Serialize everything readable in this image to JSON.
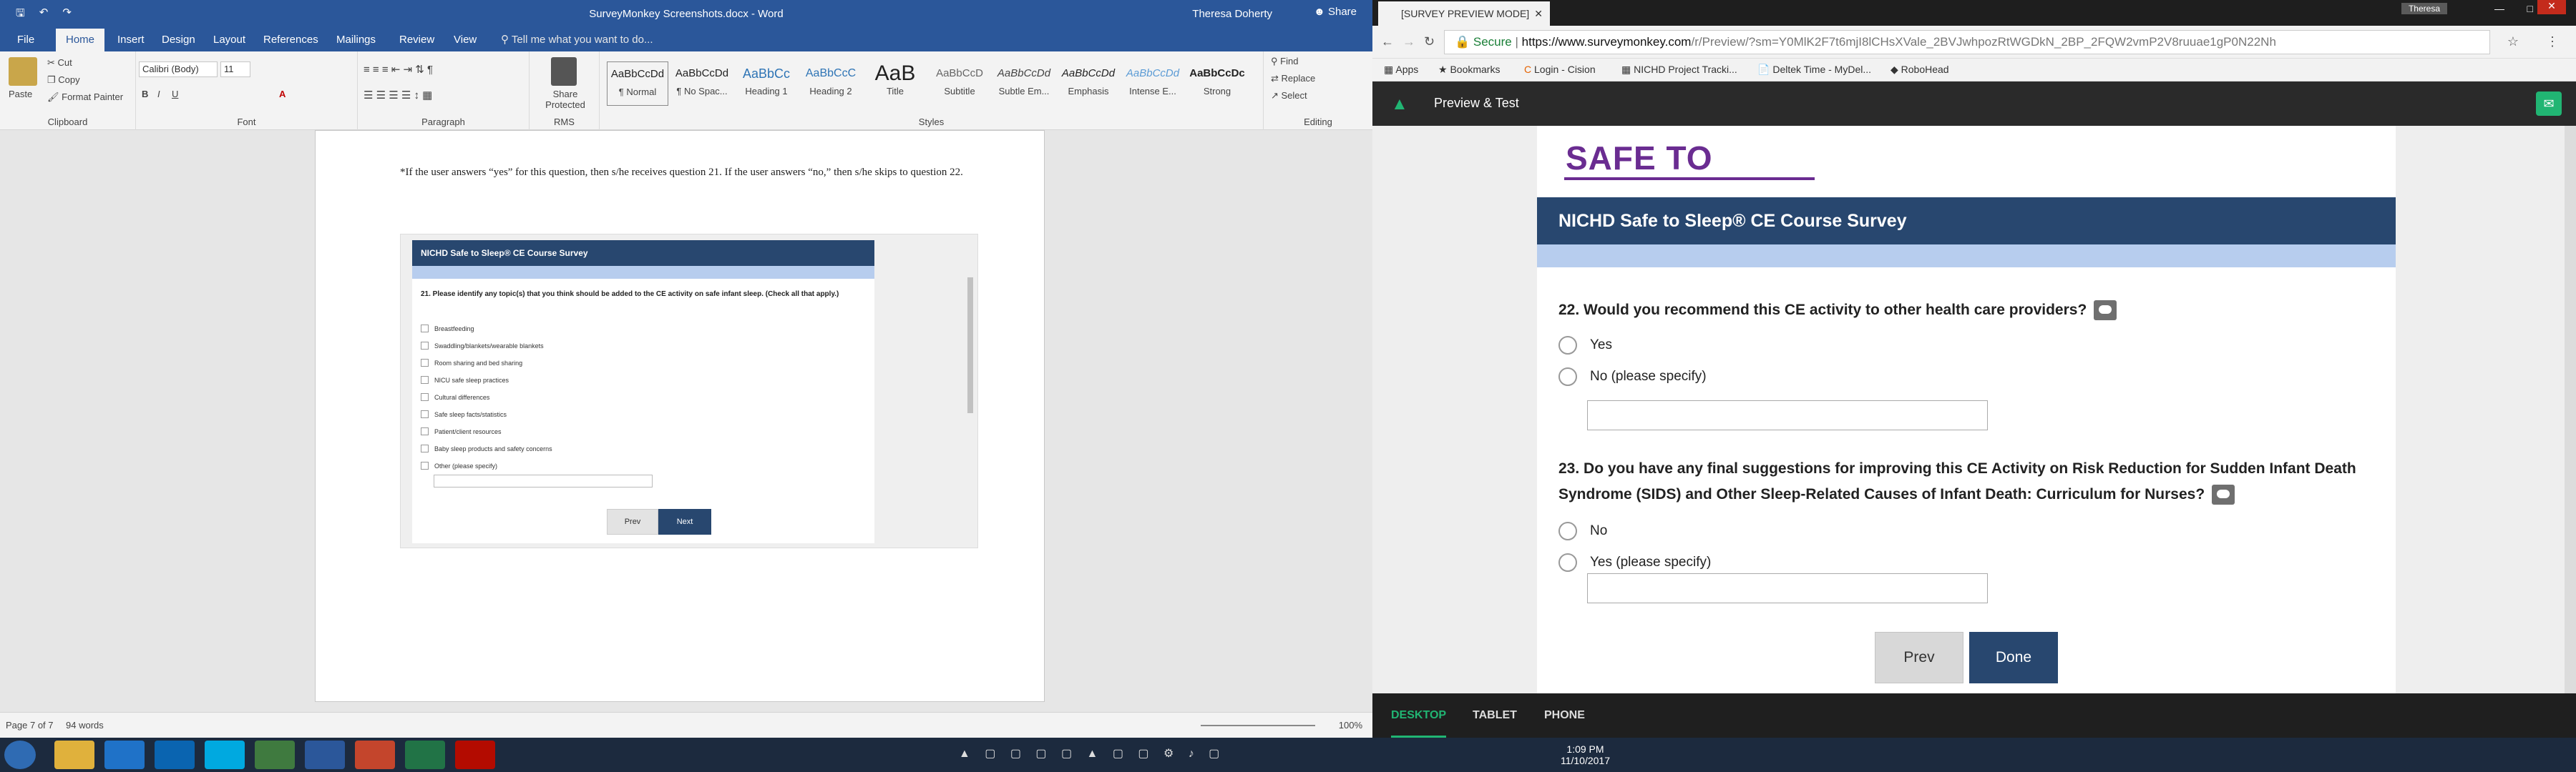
{
  "word": {
    "title": "SurveyMonkey Screenshots.docx - Word",
    "user": "Theresa Doherty",
    "share": "Share",
    "tabs": [
      "File",
      "Home",
      "Insert",
      "Design",
      "Layout",
      "References",
      "Mailings",
      "Review",
      "View"
    ],
    "tell_me": "Tell me what you want to do...",
    "clipboard": {
      "paste": "Paste",
      "cut": "Cut",
      "copy": "Copy",
      "format_painter": "Format Painter",
      "label": "Clipboard"
    },
    "font": {
      "name": "Calibri (Body)",
      "size": "11",
      "label": "Font"
    },
    "paragraph_label": "Paragraph",
    "rms": {
      "share_protected": "Share Protected",
      "label": "RMS"
    },
    "styles": [
      {
        "preview": "AaBbCcDd",
        "name": "¶ Normal"
      },
      {
        "preview": "AaBbCcDd",
        "name": "¶ No Spac..."
      },
      {
        "preview": "AaBbCc",
        "name": "Heading 1"
      },
      {
        "preview": "AaBbCcC",
        "name": "Heading 2"
      },
      {
        "preview": "AaB",
        "name": "Title"
      },
      {
        "preview": "AaBbCcD",
        "name": "Subtitle"
      },
      {
        "preview": "AaBbCcDd",
        "name": "Subtle Em..."
      },
      {
        "preview": "AaBbCcDd",
        "name": "Emphasis"
      },
      {
        "preview": "AaBbCcDd",
        "name": "Intense E..."
      },
      {
        "preview": "AaBbCcDc",
        "name": "Strong"
      }
    ],
    "styles_label": "Styles",
    "editing": {
      "find": "Find",
      "replace": "Replace",
      "select": "Select",
      "label": "Editing"
    },
    "paragraph_text": "*If the user answers “yes” for this question, then s/he receives question 21. If the user answers “no,” then s/he skips to question 22.",
    "embedded": {
      "header": "NICHD Safe to Sleep® CE Course Survey",
      "question": "21. Please identify any topic(s) that you think should be added to the CE activity on safe infant sleep. (Check all that apply.)",
      "options": [
        "Breastfeeding",
        "Swaddling/blankets/wearable blankets",
        "Room sharing and bed sharing",
        "NICU safe sleep practices",
        "Cultural differences",
        "Safe sleep facts/statistics",
        "Patient/client resources",
        "Baby sleep products and safety concerns",
        "Other (please specify)"
      ],
      "prev": "Prev",
      "next": "Next"
    },
    "status": {
      "page": "Page 7 of 7",
      "words": "94 words",
      "zoom": "100%"
    }
  },
  "chrome": {
    "tab_title": "[SURVEY PREVIEW MODE]",
    "profile": "Theresa",
    "url_secure": "Secure",
    "url_domain": "https://www.surveymonkey.com",
    "url_path": "/r/Preview/?sm=Y0MlK2F7t6mjI8lCHsXVale_2BVJwhpozRtWGDkN_2BP_2FQW2vmP2V8ruuae1gP0N22Nh",
    "bookmarks": [
      "Apps",
      "Bookmarks",
      "Login - Cision",
      "NICHD Project Tracki...",
      "Deltek Time - MyDel...",
      "RoboHead"
    ]
  },
  "survey": {
    "bar_title": "Preview & Test",
    "logo_text": "SAFE TO SLEEP",
    "header": "NICHD Safe to Sleep® CE Course Survey",
    "q22": "22. Would you recommend this CE activity to other health care providers?",
    "q22_options": [
      "Yes",
      "No (please specify)"
    ],
    "q23": "23. Do you have any final suggestions for improving this CE Activity on Risk Reduction for Sudden Infant Death Syndrome (SIDS) and Other Sleep-Related Causes of Infant Death: Curriculum for Nurses?",
    "q23_options": [
      "No",
      "Yes (please specify)"
    ],
    "prev": "Prev",
    "done": "Done",
    "devices": [
      "DESKTOP",
      "TABLET",
      "PHONE"
    ]
  },
  "taskbar": {
    "time": "1:09 PM",
    "date": "11/10/2017"
  },
  "colors": {
    "word_blue": "#2b579a",
    "survey_navy": "#28476f",
    "survey_band": "#b7cdee",
    "accent_green": "#21b573",
    "logo_purple": "#6a2c91"
  }
}
